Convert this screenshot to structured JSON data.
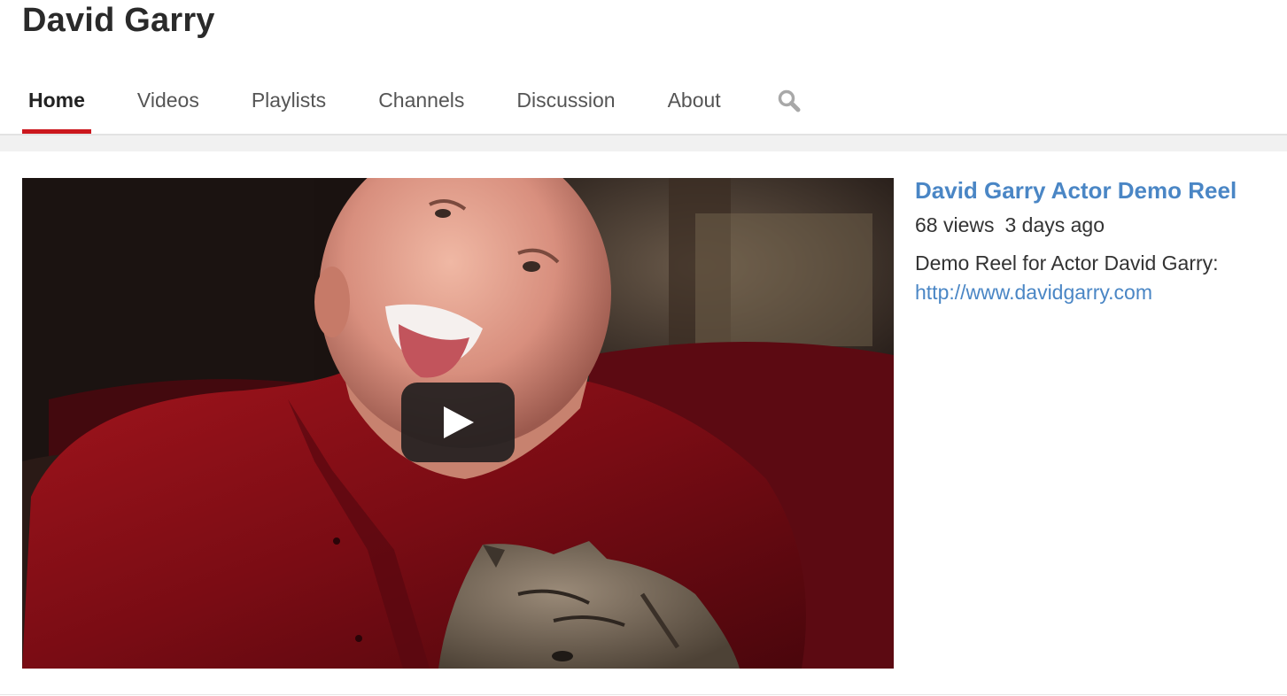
{
  "channel": {
    "name": "David Garry"
  },
  "tabs": [
    {
      "label": "Home",
      "active": true
    },
    {
      "label": "Videos",
      "active": false
    },
    {
      "label": "Playlists",
      "active": false
    },
    {
      "label": "Channels",
      "active": false
    },
    {
      "label": "Discussion",
      "active": false
    },
    {
      "label": "About",
      "active": false
    }
  ],
  "search": {
    "icon": "search-icon"
  },
  "featured_video": {
    "title": "David Garry Actor Demo Reel",
    "views": "68 views",
    "uploaded": "3 days ago",
    "description": "Demo Reel for Actor David Garry:",
    "link": "http://www.davidgarry.com",
    "play_icon": "play-icon"
  },
  "colors": {
    "accent_red": "#cc181e",
    "link_blue": "#4a86c5"
  }
}
